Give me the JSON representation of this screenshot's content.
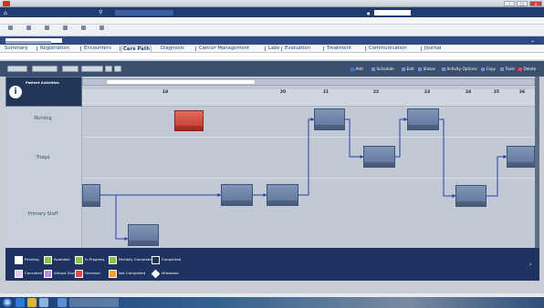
{
  "window": {
    "title": "",
    "close_label": "✕",
    "max_label": "□",
    "min_label": "–"
  },
  "header": {
    "department": "",
    "search_icon": "search-icon",
    "location": "",
    "view": "",
    "context": "",
    "user": ""
  },
  "menu": {
    "items": [
      "",
      "",
      ""
    ]
  },
  "toolbar": {
    "items": [
      "",
      "",
      "",
      "",
      "",
      ""
    ]
  },
  "patient": {
    "name": "",
    "expand_icon": "chevron-icon"
  },
  "tabs": {
    "items": [
      "Summary",
      "Registration",
      "Encounters",
      "Care Path",
      "Diagnosis",
      "Cancer Management",
      "Labs",
      "Evaluation",
      "Treatment",
      "Communication",
      "Journal"
    ],
    "active": "Care Path"
  },
  "breadcrumb": {
    "text": ""
  },
  "actions": {
    "left_buttons": [
      "",
      "",
      "",
      "",
      "",
      ""
    ],
    "right_items": [
      "Add",
      "Schedule",
      "Edit",
      "Status",
      "Activity Options",
      "Copy",
      "Tools",
      "Delete"
    ]
  },
  "info": {
    "title": "Patient Activities",
    "line1": "",
    "line2": "",
    "line3": ""
  },
  "lanes": [
    {
      "label": "Nursing"
    },
    {
      "label": "Triage"
    },
    {
      "label": "Primary Staff"
    }
  ],
  "dates": [
    {
      "day": "",
      "num": "18"
    },
    {
      "day": "",
      "num": "20"
    },
    {
      "day": "",
      "num": "21"
    },
    {
      "day": "",
      "num": "22"
    },
    {
      "day": "",
      "num": "23"
    },
    {
      "day": "",
      "num": "24"
    },
    {
      "day": "",
      "num": "25"
    },
    {
      "day": "",
      "num": "26"
    }
  ],
  "nodes": [
    {
      "id": "n1",
      "label": "",
      "foot": "",
      "color": "#c1372b"
    },
    {
      "id": "n2",
      "label": "",
      "foot": "",
      "color": "#5d7398"
    },
    {
      "id": "n3",
      "label": "",
      "foot": "",
      "color": "#5d7398"
    },
    {
      "id": "n4",
      "label": "",
      "foot": "",
      "color": "#5d7398"
    },
    {
      "id": "n5",
      "label": "",
      "foot": "",
      "color": "#5d7398"
    },
    {
      "id": "n6",
      "label": "",
      "foot": "",
      "color": "#5d7398"
    },
    {
      "id": "n7",
      "label": "",
      "foot": "",
      "color": "#5d7398"
    },
    {
      "id": "n8",
      "label": "",
      "foot": "",
      "color": "#5d7398"
    },
    {
      "id": "n9",
      "label": "",
      "foot": "",
      "color": "#5d7398"
    },
    {
      "id": "n10",
      "label": "",
      "foot": "",
      "color": "#5d7398"
    },
    {
      "id": "n11",
      "label": "",
      "foot": "",
      "color": "#5d7398"
    }
  ],
  "legend": {
    "items": [
      {
        "label": "Pending",
        "color": "#ffffff"
      },
      {
        "label": "Available",
        "color": "#8ac24a"
      },
      {
        "label": "In Progress",
        "color": "#8ac24a"
      },
      {
        "label": "Partially Completed",
        "color": "#8ac24a"
      },
      {
        "label": "Completed",
        "color": "#1f3361"
      },
      {
        "label": "Cancelled",
        "color": "#e8c8e8"
      },
      {
        "label": "Almost Due",
        "color": "#b98fd6"
      },
      {
        "label": "Overdue",
        "color": "#e24b4b"
      },
      {
        "label": "Not Completed",
        "color": "#f0a030"
      },
      {
        "label": "Milestone",
        "color": "#ffffff"
      }
    ],
    "more_icon": "chevron-right-icon"
  },
  "status": {
    "text": ""
  },
  "taskbar": {
    "time": "",
    "date": ""
  }
}
